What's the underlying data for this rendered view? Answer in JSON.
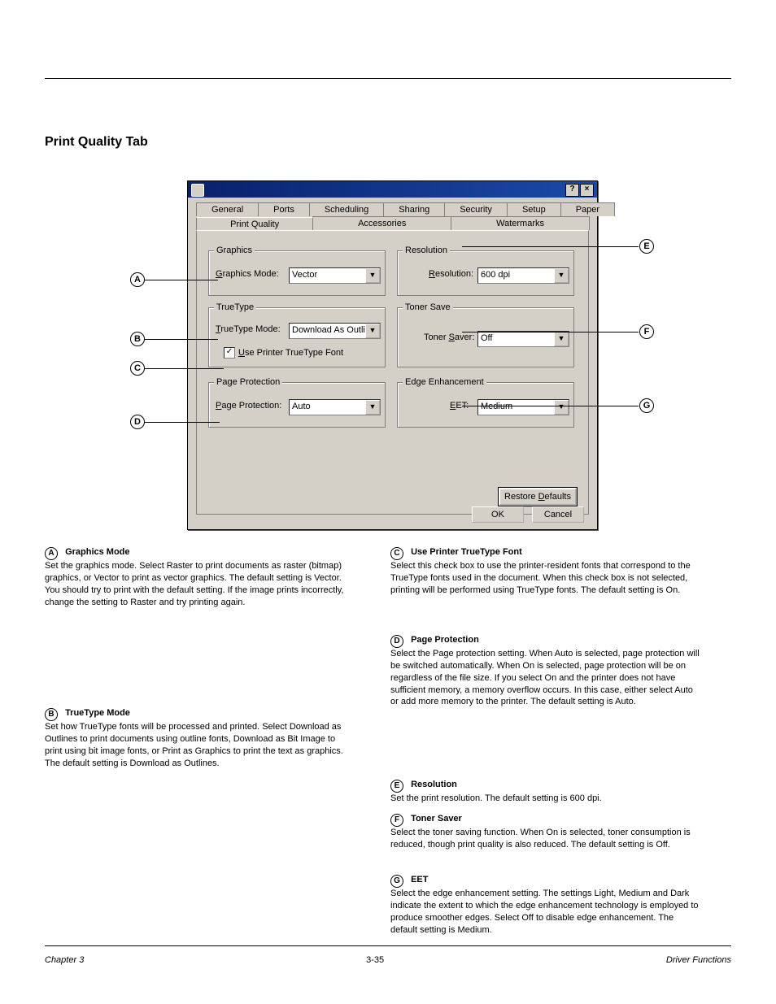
{
  "section_title": "Print Quality Tab",
  "footer": {
    "chapter": "Chapter 3",
    "page": "3-35",
    "note": "Driver Functions"
  },
  "titlebar": {
    "btn_help": "?",
    "btn_close": "×"
  },
  "tabs": {
    "row1": [
      "General",
      "Ports",
      "Scheduling",
      "Sharing",
      "Security",
      "Setup",
      "Paper"
    ],
    "row2": [
      "Print Quality",
      "Accessories",
      "Watermarks"
    ]
  },
  "groups": {
    "graphics": {
      "legend": "Graphics",
      "label": "Graphics Mode:",
      "value": "Vector"
    },
    "truetype": {
      "legend": "TrueType",
      "label": "TrueType Mode:",
      "value": "Download As Outlines",
      "checkbox": "Use Printer TrueType Font",
      "checked": "✓"
    },
    "pageprot": {
      "legend": "Page Protection",
      "label": "Page Protection:",
      "value": "Auto"
    },
    "resolution": {
      "legend": "Resolution",
      "label": "Resolution:",
      "value": "600 dpi"
    },
    "toner": {
      "legend": "Toner Save",
      "label": "Toner Saver:",
      "value": "Off"
    },
    "edge": {
      "legend": "Edge Enhancement",
      "label": "EET:",
      "value": "Medium"
    }
  },
  "buttons": {
    "restore": "Restore Defaults",
    "ok": "OK",
    "cancel": "Cancel"
  },
  "callouts": {
    "A": "A",
    "B": "B",
    "C": "C",
    "D": "D",
    "E": "E",
    "F": "F",
    "G": "G"
  },
  "desc": {
    "A": {
      "label": "Graphics Mode",
      "text": "Set the graphics mode. Select Raster to print documents as raster (bitmap) graphics, or Vector to print as vector graphics. The default setting is Vector. You should try to print with the default setting. If the image prints incorrectly, change the setting to Raster and try printing again."
    },
    "B": {
      "label": "TrueType Mode",
      "text": "Set how TrueType fonts will be processed and printed. Select Download as Outlines to print documents using outline fonts, Download as Bit Image to print using bit image fonts, or Print as Graphics to print the text as graphics. The default setting is Download as Outlines."
    },
    "C": {
      "label": "Use Printer TrueType Font",
      "text": "Select this check box to use the printer-resident fonts that correspond to the TrueType fonts used in the document. When this check box is not selected, printing will be performed using TrueType fonts. The default setting is On."
    },
    "D": {
      "label": "Page Protection",
      "text": "Select the Page protection setting. When Auto is selected, page protection will be switched automatically. When On is selected, page protection will be on regardless of the file size. If you select On and the printer does not have sufficient memory, a memory overflow occurs. In this case, either select Auto or add more memory to the printer. The default setting is Auto."
    },
    "E": {
      "label": "Resolution",
      "text": "Set the print resolution. The default setting is 600 dpi."
    },
    "F": {
      "label": "Toner Saver",
      "text": "Select the toner saving function. When On is selected, toner consumption is reduced, though print quality is also reduced. The default setting is Off."
    },
    "G": {
      "label": "EET",
      "text": "Select the edge enhancement setting. The settings Light, Medium and Dark indicate the extent to which the edge enhancement technology is employed to produce smoother edges. Select Off to disable edge enhancement. The default setting is Medium."
    }
  }
}
